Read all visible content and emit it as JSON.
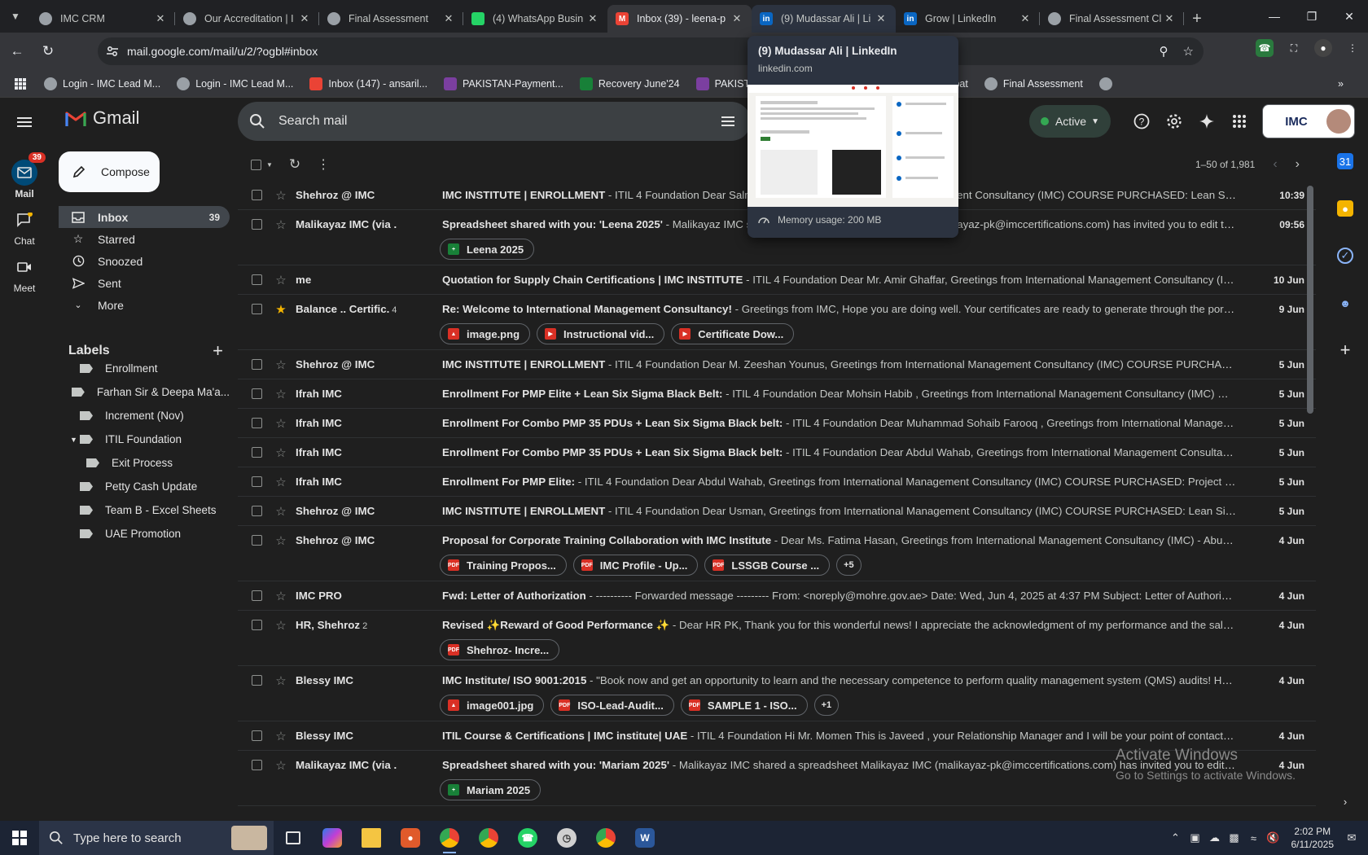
{
  "browser": {
    "tabs": [
      {
        "title": "IMC CRM",
        "icon": "crm-icon",
        "color": "#e8eaed"
      },
      {
        "title": "Our Accreditation | I",
        "icon": "imc-icon",
        "color": "#e8eaed"
      },
      {
        "title": "Final Assessment",
        "icon": "imc-icon",
        "color": "#e8eaed"
      },
      {
        "title": "(4) WhatsApp Busin",
        "icon": "whatsapp-icon",
        "color": "#25d366"
      },
      {
        "title": "Inbox (39) - leena-p",
        "icon": "gmail-icon",
        "color": "#ea4335"
      },
      {
        "title": "(9) Mudassar Ali | Li",
        "icon": "linkedin-icon",
        "color": "#0a66c2"
      },
      {
        "title": "Grow | LinkedIn",
        "icon": "linkedin-icon",
        "color": "#0a66c2"
      },
      {
        "title": "Final Assessment Cl",
        "icon": "imc-icon",
        "color": "#e8eaed"
      }
    ],
    "url": "mail.google.com/mail/u/2/?ogbl#inbox",
    "bookmarks": [
      {
        "label": "Login - IMC Lead M...",
        "icon": "imc-icon"
      },
      {
        "label": "Login - IMC Lead M...",
        "icon": "imc-icon"
      },
      {
        "label": "Inbox (147) - ansaril...",
        "icon": "gmail-icon"
      },
      {
        "label": "PAKISTAN-Payment...",
        "icon": "purple-doc-icon"
      },
      {
        "label": "Recovery June'24",
        "icon": "sheets-icon"
      },
      {
        "label": "PAKISTAN-Payme",
        "icon": "purple-doc-icon"
      },
      {
        "label": "nt Gateway",
        "icon": ""
      },
      {
        "label": "Adobe Acrobat",
        "icon": "acrobat-icon"
      },
      {
        "label": "Final Assessment",
        "icon": "imc-icon"
      }
    ]
  },
  "hover_card": {
    "title": "(9) Mudassar Ali | LinkedIn",
    "domain": "linkedin.com",
    "memory": "Memory usage: 200 MB"
  },
  "gmail": {
    "brand": "Gmail",
    "search_placeholder": "Search mail",
    "status": "Active",
    "rail": [
      {
        "label": "Mail",
        "badge": "39"
      },
      {
        "label": "Chat"
      },
      {
        "label": "Meet"
      }
    ],
    "compose": "Compose",
    "nav": [
      {
        "label": "Inbox",
        "count": "39"
      },
      {
        "label": "Starred"
      },
      {
        "label": "Snoozed"
      },
      {
        "label": "Sent"
      },
      {
        "label": "More"
      }
    ],
    "labels_title": "Labels",
    "labels": [
      {
        "label": "Enrollment"
      },
      {
        "label": "Farhan Sir & Deepa Ma'a..."
      },
      {
        "label": "Increment (Nov)"
      },
      {
        "label": "ITIL Foundation"
      },
      {
        "label": "Exit Process"
      },
      {
        "label": "Petty Cash Update"
      },
      {
        "label": "Team B - Excel Sheets"
      },
      {
        "label": "UAE Promotion"
      }
    ],
    "pager": "1–50 of 1,981",
    "imc_logo": "IMC",
    "emails": [
      {
        "sender": "Shehroz @ IMC",
        "count": "",
        "subject": "IMC INSTITUTE | ENROLLMENT",
        "snippet": " - ITIL 4 Foundation Dear Salman, Greetings from International Management Consultancy (IMC) COURSE PURCHASED: Lean Six Sigma Gre...",
        "date": "10:39",
        "starred": false
      },
      {
        "sender": "Malikayaz IMC (via .",
        "count": "",
        "subject": "Spreadsheet shared with you: 'Leena 2025'",
        "snippet": " - Malikayaz IMC shared a spreadsheet Malikayaz IMC (malikayaz-pk@imccertifications.com) has invited you to edit the followi...",
        "date": "09:56",
        "starred": false
      },
      {
        "sender": "me",
        "count": "",
        "subject": "Quotation for Supply Chain Certifications | IMC INSTITUTE",
        "snippet": " - ITIL 4 Foundation Dear Mr. Amir Ghaffar, Greetings from International Management Consultancy (IMC) COURS...",
        "date": "10 Jun",
        "starred": false
      },
      {
        "sender": "Balance .. Certific.",
        "count": "4",
        "subject": "Re: Welcome to International Management Consultancy!",
        "snippet": " - Greetings from IMC, Hope you are doing well. Your certificates are ready to generate through the portal. please ...",
        "date": "9 Jun",
        "starred": true
      },
      {
        "sender": "Shehroz @ IMC",
        "count": "",
        "subject": "IMC INSTITUTE | ENROLLMENT",
        "snippet": " - ITIL 4 Foundation Dear M. Zeeshan Younus, Greetings from International Management Consultancy (IMC) COURSE PURCHASED: Lean Six...",
        "date": "5 Jun",
        "starred": false
      },
      {
        "sender": "Ifrah IMC",
        "count": "",
        "subject": "Enrollment For PMP Elite + Lean Six Sigma Black Belt:",
        "snippet": " - ITIL 4 Foundation Dear Mohsin Habib , Greetings from International Management Consultancy (IMC) COURSE PUR...",
        "date": "5 Jun",
        "starred": false
      },
      {
        "sender": "Ifrah IMC",
        "count": "",
        "subject": "Enrollment For Combo PMP 35 PDUs + Lean Six Sigma Black belt:",
        "snippet": " - ITIL 4 Foundation Dear Muhammad Sohaib Farooq , Greetings from International Management Consult...",
        "date": "5 Jun",
        "starred": false
      },
      {
        "sender": "Ifrah IMC",
        "count": "",
        "subject": "Enrollment For Combo PMP 35 PDUs + Lean Six Sigma Black belt:",
        "snippet": " - ITIL 4 Foundation Dear Abdul Wahab, Greetings from International Management Consultancy (IMC) CO...",
        "date": "5 Jun",
        "starred": false
      },
      {
        "sender": "Ifrah IMC",
        "count": "",
        "subject": "Enrollment For PMP Elite:",
        "snippet": " - ITIL 4 Foundation Dear Abdul Wahab, Greetings from International Management Consultancy (IMC) COURSE PURCHASED: Project Managemen...",
        "date": "5 Jun",
        "starred": false
      },
      {
        "sender": "Shehroz @ IMC",
        "count": "",
        "subject": "IMC INSTITUTE | ENROLLMENT",
        "snippet": " - ITIL 4 Foundation Dear Usman, Greetings from International Management Consultancy (IMC) COURSE PURCHASED: Lean Six Sigma Gree...",
        "date": "5 Jun",
        "starred": false
      },
      {
        "sender": "Shehroz @ IMC",
        "count": "",
        "subject": "Proposal for Corporate Training Collaboration with IMC Institute",
        "snippet": " - Dear Ms. Fatima Hasan, Greetings from International Management Consultancy (IMC) - Abu Dhabi, Unite...",
        "date": "4 Jun",
        "starred": false
      },
      {
        "sender": "IMC PRO",
        "count": "",
        "subject": "Fwd: Letter of Authorization",
        "snippet": " - ---------- Forwarded message --------- From: <noreply@mohre.gov.ae> Date: Wed, Jun 4, 2025 at 4:37 PM Subject: Letter of Authorization ...",
        "date": "4 Jun",
        "starred": false
      },
      {
        "sender": "HR, Shehroz",
        "count": "2",
        "subject": "Revised ✨Reward of Good Performance ✨",
        "snippet": " - Dear HR PK, Thank you for this wonderful news! I appreciate the acknowledgment of my performance and the salary increm...",
        "date": "4 Jun",
        "starred": false
      },
      {
        "sender": "Blessy IMC",
        "count": "",
        "subject": "IMC Institute/ ISO 9001:2015",
        "snippet": " - \"Book now and get an opportunity to learn and the necessary competence to perform quality management system (QMS) audits! Hello! Mr ...",
        "date": "4 Jun",
        "starred": false
      },
      {
        "sender": "Blessy IMC",
        "count": "",
        "subject": "ITIL Course & Certifications | IMC institute| UAE",
        "snippet": " - ITIL 4 Foundation Hi Mr. Momen This is Javeed , your Relationship Manager and I will be your point of contact from IMC f...",
        "date": "4 Jun",
        "starred": false
      },
      {
        "sender": "Malikayaz IMC (via .",
        "count": "",
        "subject": "Spreadsheet shared with you: 'Mariam 2025'",
        "snippet": " - Malikayaz IMC shared a spreadsheet Malikayaz IMC (malikayaz-pk@imccertifications.com) has invited you to edit the follo...",
        "date": "4 Jun",
        "starred": false
      }
    ],
    "attachments": {
      "r1": [
        {
          "name": "Leena 2025",
          "type": "sheets"
        }
      ],
      "r3": [
        {
          "name": "image.png",
          "type": "image"
        },
        {
          "name": "Instructional vid...",
          "type": "video"
        },
        {
          "name": "Certificate Dow...",
          "type": "video"
        }
      ],
      "r10": [
        {
          "name": "Training Propos...",
          "type": "pdf"
        },
        {
          "name": "IMC Profile - Up...",
          "type": "pdf"
        },
        {
          "name": "LSSGB Course ...",
          "type": "pdf"
        }
      ],
      "r10_more": "+5",
      "r12": [
        {
          "name": "Shehroz- Incre...",
          "type": "pdf"
        }
      ],
      "r13": [
        {
          "name": "image001.jpg",
          "type": "image"
        },
        {
          "name": "ISO-Lead-Audit...",
          "type": "pdf"
        },
        {
          "name": "SAMPLE 1 - ISO...",
          "type": "pdf"
        }
      ],
      "r13_more": "+1",
      "r15": [
        {
          "name": "Mariam 2025",
          "type": "sheets"
        }
      ]
    }
  },
  "watermark": {
    "line1": "Activate Windows",
    "line2": "Go to Settings to activate Windows."
  },
  "taskbar": {
    "search_placeholder": "Type here to search",
    "time": "2:02 PM",
    "date": "6/11/2025"
  },
  "colors": {
    "pdf": "#d93025",
    "sheets": "#188038",
    "image": "#d93025",
    "video": "#d93025",
    "accent": "#8ab4f8"
  }
}
